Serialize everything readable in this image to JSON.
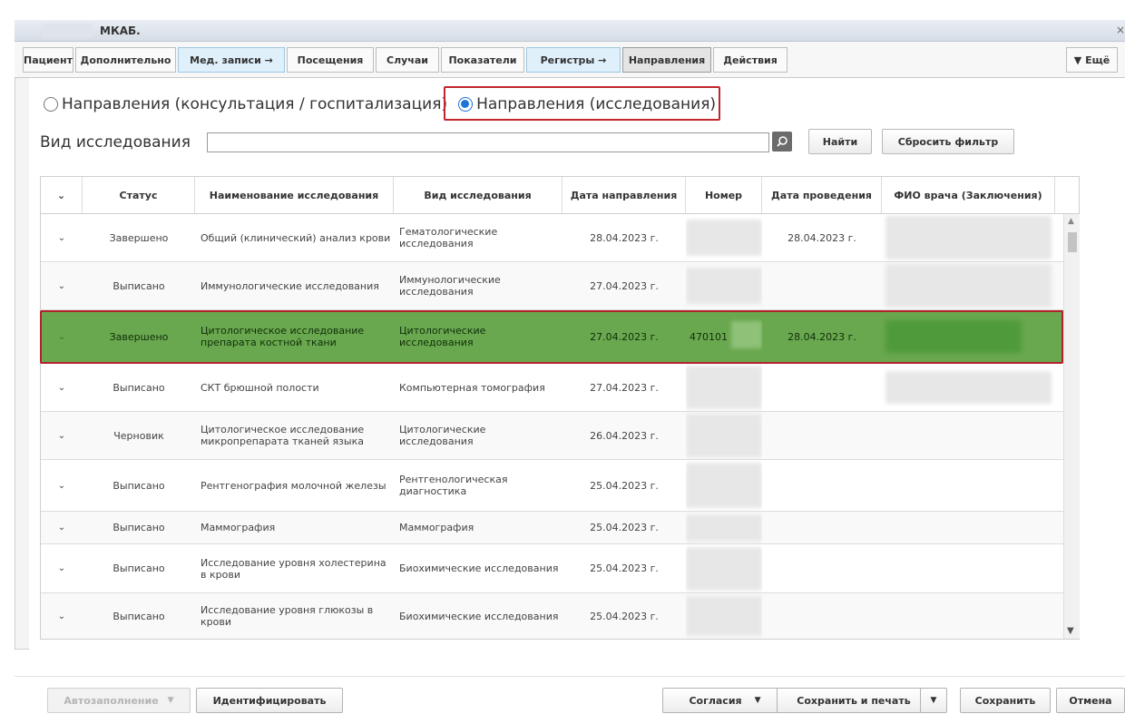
{
  "window": {
    "title": "МКАБ."
  },
  "tabs": [
    {
      "label": "Пациент"
    },
    {
      "label": "Дополнительно"
    },
    {
      "label": "Мед. записи →"
    },
    {
      "label": "Посещения"
    },
    {
      "label": "Случаи"
    },
    {
      "label": "Показатели"
    },
    {
      "label": "Регистры →"
    },
    {
      "label": "Направления"
    },
    {
      "label": "Действия"
    },
    {
      "label": "▼ Ещё"
    }
  ],
  "mode": {
    "option1": "Направления (консультация / госпитализация)",
    "option2": "Направления (исследования)",
    "selected": "option2"
  },
  "filter": {
    "label": "Вид исследования",
    "value": "",
    "find": "Найти",
    "reset": "Сбросить фильтр"
  },
  "table": {
    "columns": [
      "",
      "Статус",
      "Наименование исследования",
      "Вид исследования",
      "Дата направления",
      "Номер",
      "Дата проведения",
      "ФИО врача (Заключения)"
    ],
    "rows": [
      {
        "status": "Завершено",
        "name": "Общий (клинический) анализ крови",
        "kind": "Гематологические исследования",
        "date": "28.04.2023 г.",
        "number": "",
        "done": "28.04.2023 г.",
        "doctor": ""
      },
      {
        "status": "Выписано",
        "name": "Иммунологические исследования",
        "kind": "Иммунологические исследования",
        "date": "27.04.2023 г.",
        "number": "",
        "done": "",
        "doctor": ""
      },
      {
        "status": "Завершено",
        "name": "Цитологическое исследование препарата костной ткани",
        "kind": "Цитологические исследования",
        "date": "27.04.2023 г.",
        "number": "470101",
        "done": "28.04.2023 г.",
        "doctor": ""
      },
      {
        "status": "Выписано",
        "name": "СКТ брюшной полости",
        "kind": "Компьютерная томография",
        "date": "27.04.2023 г.",
        "number": "",
        "done": "",
        "doctor": ""
      },
      {
        "status": "Черновик",
        "name": "Цитологическое исследование микропрепарата тканей языка",
        "kind": "Цитологические исследования",
        "date": "26.04.2023 г.",
        "number": "",
        "done": "",
        "doctor": ""
      },
      {
        "status": "Выписано",
        "name": "Рентгенография молочной железы",
        "kind": "Рентгенологическая диагностика",
        "date": "25.04.2023 г.",
        "number": "",
        "done": "",
        "doctor": ""
      },
      {
        "status": "Выписано",
        "name": "Маммография",
        "kind": "Маммография",
        "date": "25.04.2023 г.",
        "number": "",
        "done": "",
        "doctor": ""
      },
      {
        "status": "Выписано",
        "name": "Исследование уровня холестерина в крови",
        "kind": "Биохимические исследования",
        "date": "25.04.2023 г.",
        "number": "",
        "done": "",
        "doctor": ""
      },
      {
        "status": "Выписано",
        "name": "Исследование уровня глюкозы в крови",
        "kind": "Биохимические исследования",
        "date": "25.04.2023 г.",
        "number": "",
        "done": "",
        "doctor": ""
      }
    ]
  },
  "footer": {
    "autofill": "Автозаполнение",
    "identify": "Идентифицировать",
    "consents": "Согласия",
    "save_print": "Сохранить и печать",
    "save": "Сохранить",
    "cancel": "Отмена"
  },
  "colors": {
    "selected_row": "#6aa84f",
    "highlight_border": "#c0262d",
    "radio_accent": "#1e73d8"
  }
}
